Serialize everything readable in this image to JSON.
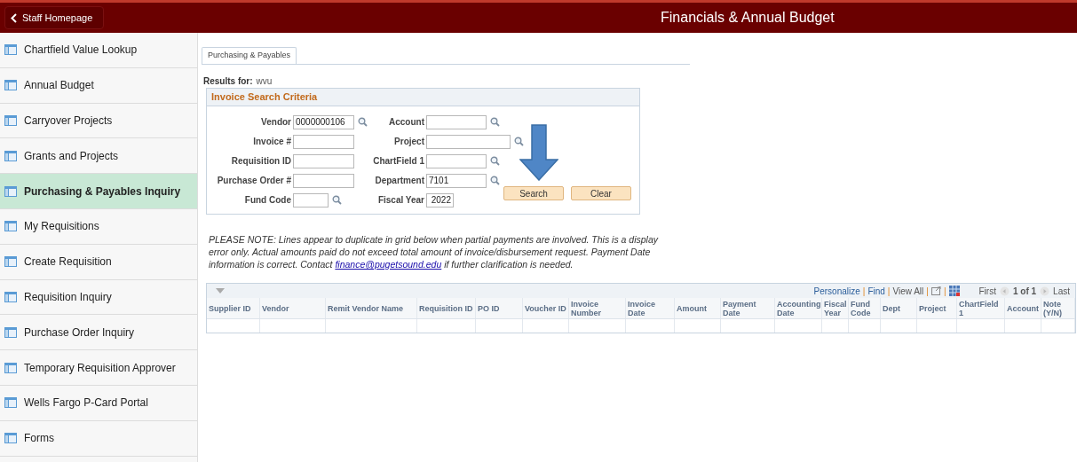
{
  "header": {
    "back_button": "Staff Homepage",
    "title": "Financials & Annual Budget"
  },
  "sidebar": {
    "items": [
      {
        "label": "Chartfield Value Lookup",
        "selected": false
      },
      {
        "label": "Annual Budget",
        "selected": false
      },
      {
        "label": "Carryover Projects",
        "selected": false
      },
      {
        "label": "Grants and Projects",
        "selected": false
      },
      {
        "label": "Purchasing & Payables Inquiry",
        "selected": true
      },
      {
        "label": "My Requisitions",
        "selected": false
      },
      {
        "label": "Create Requisition",
        "selected": false
      },
      {
        "label": "Requisition Inquiry",
        "selected": false
      },
      {
        "label": "Purchase Order Inquiry",
        "selected": false
      },
      {
        "label": "Temporary Requisition Approver",
        "selected": false
      },
      {
        "label": "Wells Fargo P-Card Portal",
        "selected": false
      },
      {
        "label": "Forms",
        "selected": false
      }
    ]
  },
  "tabs": [
    {
      "label": "Purchasing & Payables",
      "selected": true
    }
  ],
  "results_for": {
    "label": "Results for:",
    "value": "wvu"
  },
  "criteria": {
    "title": "Invoice Search Criteria",
    "rows": [
      [
        {
          "label": "Vendor",
          "value": "0000000106",
          "lookup": true
        },
        {
          "label": "Account",
          "lookup": true
        }
      ],
      [
        {
          "label": "Invoice #",
          "lookup": false
        },
        {
          "label": "Project",
          "lookup": true
        }
      ],
      [
        {
          "label": "Requisition ID",
          "lookup": false
        },
        {
          "label": "ChartField 1",
          "lookup": true
        }
      ],
      [
        {
          "label": "Purchase Order #",
          "lookup": false
        },
        {
          "label": "Department",
          "value": "7101",
          "lookup": true
        }
      ],
      [
        {
          "label": "Fund Code",
          "lookup": true
        },
        {
          "label": "Fiscal Year",
          "value": "2022",
          "lookup": false
        }
      ]
    ],
    "buttons": [
      "Search",
      "Clear"
    ]
  },
  "note": {
    "text": "PLEASE NOTE: Lines appear to duplicate in grid below when partial payments are involved. This is a display error only. Actual amounts paid do not exceed total amount of invoice/disbursement request. Payment Date information is correct. Contact",
    "link": "finance@pugetsound.edu",
    "after": "if further clarification is needed."
  },
  "grid": {
    "separator": "|",
    "toolbar": [
      "Personalize",
      "Find",
      "View All"
    ],
    "pager": {
      "first": "First",
      "position": "1 of 1",
      "last": "Last"
    },
    "columns": [
      "Supplier ID",
      "Vendor",
      "Remit Vendor Name",
      "Requisition ID",
      "PO ID",
      "Voucher ID",
      "Invoice Number",
      "Invoice Date",
      "Amount",
      "Payment Date",
      "Accounting Date",
      "Fiscal Year",
      "Fund Code",
      "Dept",
      "Project",
      "ChartField 1",
      "Account",
      "Note (Y/N)"
    ]
  }
}
